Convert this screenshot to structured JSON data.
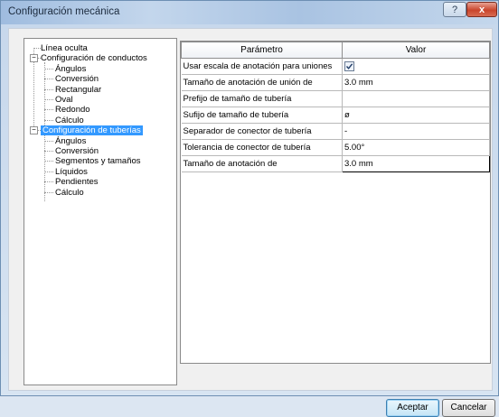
{
  "window": {
    "title": "Configuración mecánica",
    "help_label": "?",
    "close_label": "x"
  },
  "tree": {
    "items": [
      {
        "label": "Línea oculta"
      },
      {
        "label": "Configuración de conductos",
        "expand": "−"
      },
      {
        "label": "Ángulos"
      },
      {
        "label": "Conversión"
      },
      {
        "label": "Rectangular"
      },
      {
        "label": "Oval"
      },
      {
        "label": "Redondo"
      },
      {
        "label": "Cálculo"
      },
      {
        "label": "Configuración de tuberías",
        "expand": "−",
        "selected": true
      },
      {
        "label": "Ángulos"
      },
      {
        "label": "Conversión"
      },
      {
        "label": "Segmentos y tamaños"
      },
      {
        "label": "Líquidos"
      },
      {
        "label": "Pendientes"
      },
      {
        "label": "Cálculo"
      }
    ]
  },
  "grid": {
    "headers": {
      "param": "Parámetro",
      "value": "Valor"
    },
    "rows": [
      {
        "param": "Usar escala de anotación para uniones",
        "value": "",
        "checkbox": true,
        "checked": true
      },
      {
        "param": "Tamaño de anotación de unión de",
        "value": "3.0 mm"
      },
      {
        "param": "Prefijo de tamaño de tubería",
        "value": ""
      },
      {
        "param": "Sufijo de tamaño de tubería",
        "value": "ø"
      },
      {
        "param": "Separador de conector de tubería",
        "value": "-"
      },
      {
        "param": "Tolerancia de conector de tubería",
        "value": "5.00°"
      },
      {
        "param": "Tamaño de anotación de",
        "value": "3.0 mm",
        "editing": true
      }
    ]
  },
  "buttons": {
    "ok": "Aceptar",
    "cancel": "Cancelar"
  },
  "colors": {
    "selection": "#3399ff",
    "close": "#c9452c",
    "title_bar": "#b9d1ea"
  }
}
